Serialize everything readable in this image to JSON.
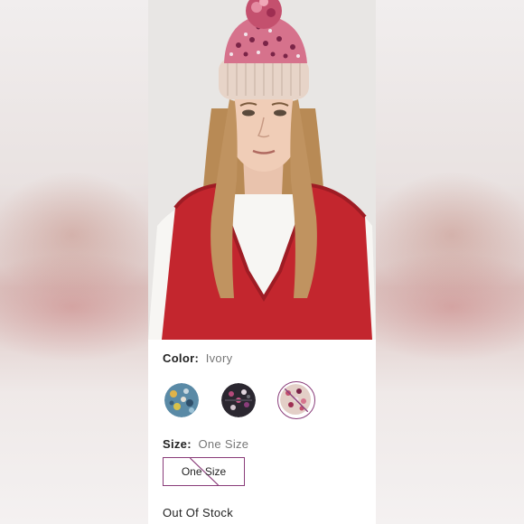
{
  "product": {
    "color_label": "Color:",
    "color_value": "Ivory",
    "swatches": [
      {
        "name": "blue-multi",
        "selected": false,
        "unavailable": false
      },
      {
        "name": "black-multi",
        "selected": false,
        "unavailable": false
      },
      {
        "name": "ivory",
        "selected": true,
        "unavailable": true
      }
    ],
    "size_label": "Size:",
    "size_value": "One Size",
    "size_option": "One Size",
    "stock_status": "Out Of Stock"
  },
  "colors": {
    "accent": "#8a3d7a",
    "vest_red": "#c3262e",
    "hat_pink": "#d6728c",
    "hat_cream": "#e7d4c8"
  }
}
